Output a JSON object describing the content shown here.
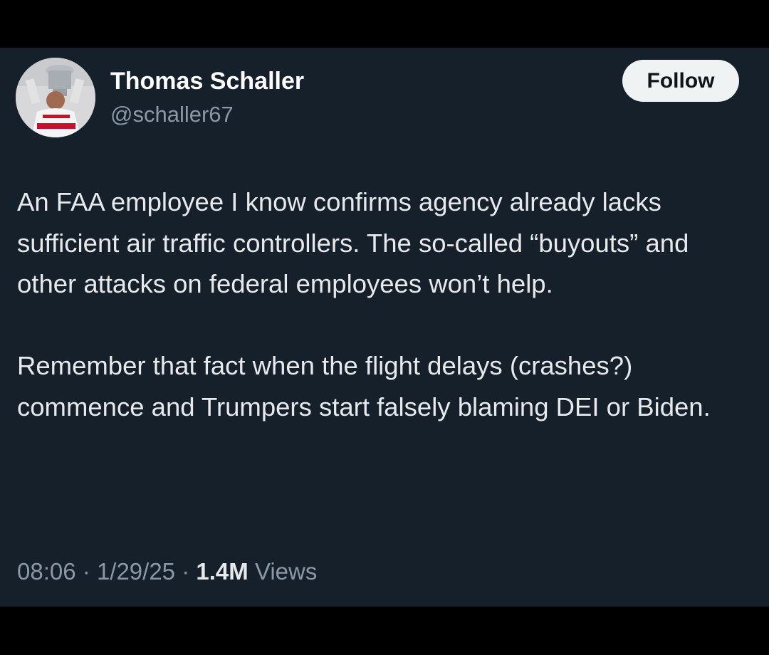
{
  "author": {
    "name": "Thomas Schaller",
    "handle": "@schaller67",
    "avatar": "profile-photo-hockey-player-raising-trophy"
  },
  "follow_label": "Follow",
  "tweet": {
    "paragraphs": [
      "An FAA employee I know confirms agency already lacks sufficient air traffic controllers. The so-called “buyouts” and other attacks on federal employees won’t help.",
      "Remember that fact when the flight delays (crashes?) commence and Trumpers start falsely blaming DEI or Biden."
    ]
  },
  "meta": {
    "time": "08:06",
    "separator": "·",
    "date": "1/29/25",
    "views_count": "1.4M",
    "views_label": "Views"
  },
  "colors": {
    "background": "#15202b",
    "text": "#e7e9ea",
    "secondary_text": "#8b98a5",
    "button_bg": "#eff3f4",
    "button_text": "#0f1419"
  }
}
